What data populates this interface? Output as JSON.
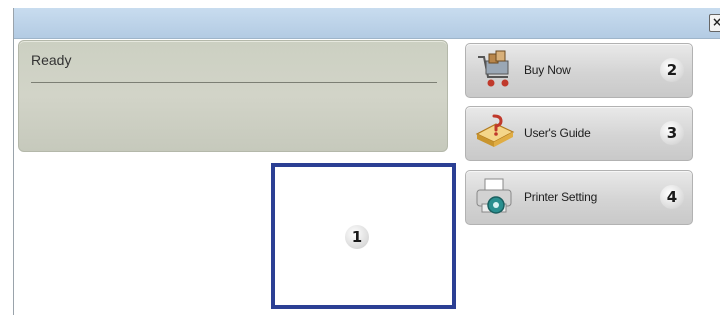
{
  "window": {
    "close_glyph": "×"
  },
  "status": {
    "text": "Ready"
  },
  "frame": {
    "callout": "1"
  },
  "buttons": [
    {
      "label": "Buy Now",
      "callout": "2",
      "icon": "shopping-cart-icon"
    },
    {
      "label": "User's Guide",
      "callout": "3",
      "icon": "book-icon"
    },
    {
      "label": "Printer Setting",
      "callout": "4",
      "icon": "printer-settings-icon"
    }
  ],
  "colors": {
    "titlebar": "#b9cfe6",
    "frame_border": "#2b3f94",
    "status_panel": "#cfd2c5"
  }
}
